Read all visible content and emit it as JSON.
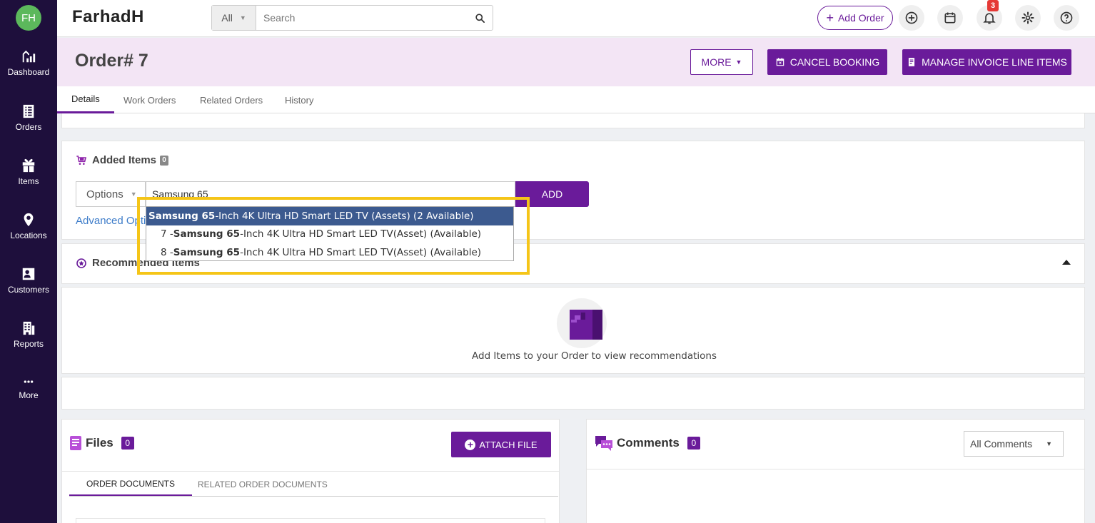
{
  "user": {
    "initials": "FH"
  },
  "sidebar": {
    "items": [
      {
        "label": "Dashboard",
        "icon": "dashboard-icon"
      },
      {
        "label": "Orders",
        "icon": "orders-icon"
      },
      {
        "label": "Items",
        "icon": "gift-icon"
      },
      {
        "label": "Locations",
        "icon": "location-pin-icon"
      },
      {
        "label": "Customers",
        "icon": "customers-icon"
      },
      {
        "label": "Reports",
        "icon": "building-icon"
      },
      {
        "label": "More",
        "icon": "more-dots-icon"
      }
    ]
  },
  "header": {
    "brand": "FarhadH",
    "search": {
      "scope": "All",
      "placeholder": "Search"
    },
    "add_order_label": "Add Order",
    "notification_count": "3"
  },
  "order": {
    "title": "Order# 7",
    "more_label": "MORE",
    "cancel_label": "CANCEL BOOKING",
    "invoice_label": "MANAGE INVOICE LINE ITEMS"
  },
  "tabs": [
    {
      "label": "Details",
      "active": true
    },
    {
      "label": "Work Orders",
      "active": false
    },
    {
      "label": "Related Orders",
      "active": false
    },
    {
      "label": "History",
      "active": false
    }
  ],
  "added_items": {
    "title": "Added Items",
    "count": "0",
    "options_label": "Options",
    "input_value": "Samsung 65",
    "add_label": "ADD",
    "advanced_label": "Advanced Options"
  },
  "dropdown": {
    "rows": [
      {
        "prefix": "",
        "match": "Samsung 65",
        "rest": "-Inch 4K Ultra HD Smart LED TV (Assets) (2 Available)"
      },
      {
        "prefix": "7 - ",
        "match": "Samsung 65",
        "rest": "-Inch 4K Ultra HD Smart LED TV(Asset) (Available)"
      },
      {
        "prefix": "8 - ",
        "match": "Samsung 65",
        "rest": "-Inch 4K Ultra HD Smart LED TV(Asset) (Available)"
      }
    ]
  },
  "recommended": {
    "title": "Recommended Items",
    "empty_text": "Add Items to your Order to view recommendations"
  },
  "files": {
    "title": "Files",
    "count": "0",
    "attach_label": "ATTACH FILE",
    "tabs": [
      "ORDER DOCUMENTS",
      "RELATED ORDER DOCUMENTS"
    ]
  },
  "comments": {
    "title": "Comments",
    "count": "0",
    "filter": "All Comments"
  },
  "colors": {
    "accent": "#6a1b9a",
    "sidebar_bg": "#1e0f3c",
    "title_band": "#f3e5f5",
    "highlight": "#f5c518",
    "dropdown_selected": "#3c5a8f"
  }
}
